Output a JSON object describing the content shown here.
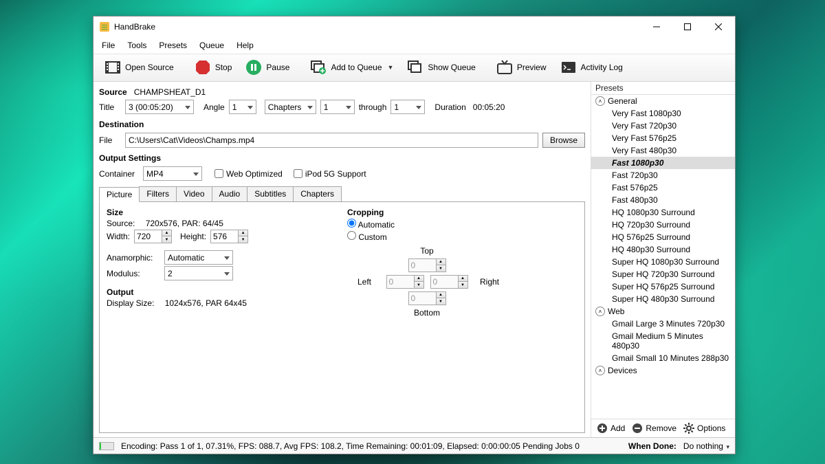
{
  "window": {
    "title": "HandBrake"
  },
  "menu": [
    "File",
    "Tools",
    "Presets",
    "Queue",
    "Help"
  ],
  "toolbar": {
    "open_source": "Open Source",
    "stop": "Stop",
    "pause": "Pause",
    "add_to_queue": "Add to Queue",
    "show_queue": "Show Queue",
    "preview": "Preview",
    "activity_log": "Activity Log"
  },
  "source": {
    "label": "Source",
    "name": "CHAMPSHEAT_D1",
    "title_label": "Title",
    "title_value": "3 (00:05:20)",
    "angle_label": "Angle",
    "angle_value": "1",
    "chapters_mode": "Chapters",
    "from": "1",
    "through_label": "through",
    "to": "1",
    "duration_label": "Duration",
    "duration_value": "00:05:20"
  },
  "destination": {
    "section": "Destination",
    "file_label": "File",
    "file_value": "C:\\Users\\Cat\\Videos\\Champs.mp4",
    "browse": "Browse"
  },
  "output": {
    "section": "Output Settings",
    "container_label": "Container",
    "container_value": "MP4",
    "web_optimized": "Web Optimized",
    "ipod": "iPod 5G Support"
  },
  "tabs": [
    "Picture",
    "Filters",
    "Video",
    "Audio",
    "Subtitles",
    "Chapters"
  ],
  "picture": {
    "size_label": "Size",
    "source_label": "Source:",
    "source_value": "720x576, PAR: 64/45",
    "width_label": "Width:",
    "width_value": "720",
    "height_label": "Height:",
    "height_value": "576",
    "anamorphic_label": "Anamorphic:",
    "anamorphic_value": "Automatic",
    "modulus_label": "Modulus:",
    "modulus_value": "2",
    "output_label": "Output",
    "display_size_label": "Display Size:",
    "display_size_value": "1024x576,  PAR 64x45",
    "cropping_label": "Cropping",
    "auto": "Automatic",
    "custom": "Custom",
    "top": "Top",
    "left": "Left",
    "right": "Right",
    "bottom": "Bottom",
    "crop_top": "0",
    "crop_left": "0",
    "crop_right": "0",
    "crop_bottom": "0"
  },
  "presets": {
    "header": "Presets",
    "groups": [
      {
        "name": "General",
        "items": [
          "Very Fast 1080p30",
          "Very Fast 720p30",
          "Very Fast 576p25",
          "Very Fast 480p30",
          "Fast 1080p30",
          "Fast 720p30",
          "Fast 576p25",
          "Fast 480p30",
          "HQ 1080p30 Surround",
          "HQ 720p30 Surround",
          "HQ 576p25 Surround",
          "HQ 480p30 Surround",
          "Super HQ 1080p30 Surround",
          "Super HQ 720p30 Surround",
          "Super HQ 576p25 Surround",
          "Super HQ 480p30 Surround"
        ]
      },
      {
        "name": "Web",
        "items": [
          "Gmail Large 3 Minutes 720p30",
          "Gmail Medium 5 Minutes 480p30",
          "Gmail Small 10 Minutes 288p30"
        ]
      },
      {
        "name": "Devices",
        "items": []
      }
    ],
    "selected": "Fast 1080p30",
    "add": "Add",
    "remove": "Remove",
    "options": "Options"
  },
  "status": {
    "text": "Encoding: Pass 1 of 1,  07.31%, FPS: 088.7,  Avg FPS: 108.2,  Time Remaining: 00:01:09,  Elapsed: 0:00:00:05   Pending Jobs 0",
    "when_done_label": "When Done:",
    "when_done_value": "Do nothing"
  }
}
